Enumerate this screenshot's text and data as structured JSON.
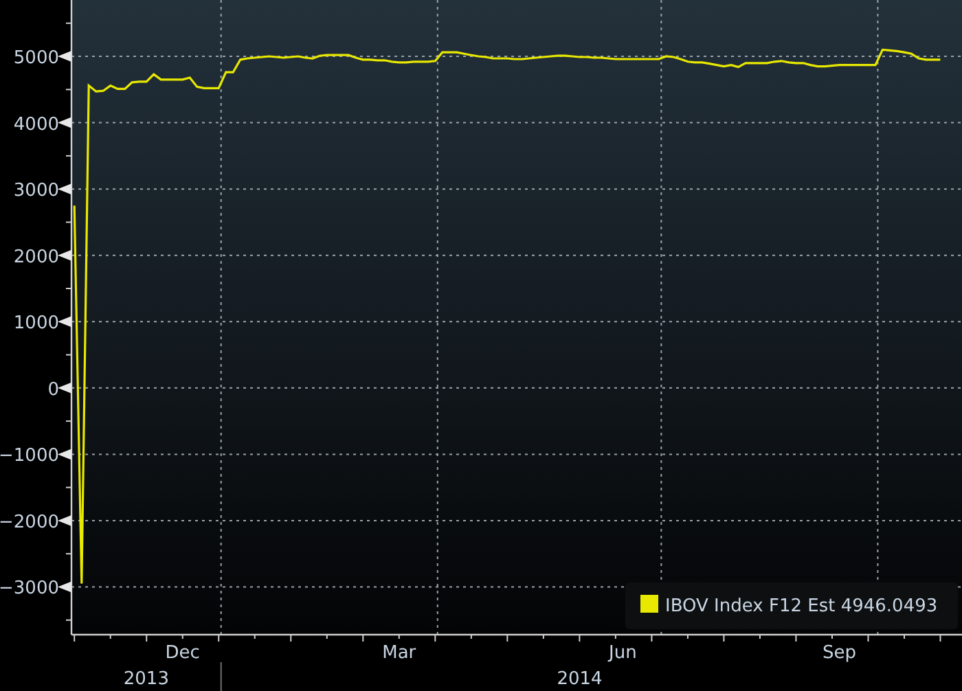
{
  "chart_data": {
    "type": "line",
    "grid": true,
    "ylim": [
      -3720,
      5850
    ],
    "yticks": [
      -3000,
      -2000,
      -1000,
      0,
      1000,
      2000,
      3000,
      4000,
      5000
    ],
    "categories": [
      null,
      null,
      null,
      null,
      null,
      null,
      null,
      null,
      null,
      null,
      null,
      null,
      null,
      null,
      null,
      "Dec",
      null,
      null,
      null,
      null,
      null,
      null,
      null,
      null,
      null,
      null,
      null,
      null,
      null,
      null,
      null,
      null,
      null,
      null,
      null,
      null,
      null,
      null,
      null,
      null,
      null,
      null,
      null,
      null,
      null,
      "Mar",
      null,
      null,
      null,
      null,
      null,
      null,
      null,
      null,
      null,
      null,
      null,
      null,
      null,
      null,
      null,
      null,
      null,
      null,
      null,
      null,
      null,
      null,
      null,
      null,
      null,
      null,
      null,
      null,
      null,
      null,
      "Jun",
      null,
      null,
      null,
      null,
      null,
      null,
      null,
      null,
      null,
      null,
      null,
      null,
      null,
      null,
      null,
      null,
      null,
      null,
      null,
      null,
      null,
      null,
      null,
      null,
      null,
      null,
      null,
      null,
      null,
      "Sep",
      null,
      null,
      null,
      null,
      null,
      null,
      null,
      null,
      null,
      null,
      null,
      null,
      null,
      null
    ],
    "annotations": [
      "2013",
      "2014"
    ],
    "series": [
      {
        "name": "IBOV Index F12 Est 4946.0493",
        "color": "#e8e800",
        "values": [
          2750,
          -2950,
          4560,
          4470,
          4480,
          4560,
          4510,
          4510,
          4610,
          4620,
          4620,
          4730,
          4650,
          4650,
          4650,
          4650,
          4680,
          4540,
          4520,
          4520,
          4520,
          4760,
          4760,
          4950,
          4970,
          4980,
          4990,
          5000,
          4990,
          4980,
          4990,
          5000,
          4980,
          4970,
          5010,
          5020,
          5020,
          5020,
          5020,
          4980,
          4950,
          4950,
          4940,
          4940,
          4920,
          4910,
          4910,
          4920,
          4920,
          4920,
          4930,
          5060,
          5060,
          5060,
          5040,
          5020,
          5000,
          4990,
          4970,
          4970,
          4970,
          4960,
          4960,
          4970,
          4980,
          4990,
          5000,
          5010,
          5010,
          5000,
          4990,
          4990,
          4980,
          4980,
          4970,
          4960,
          4960,
          4960,
          4960,
          4960,
          4960,
          4960,
          5000,
          4990,
          4960,
          4920,
          4910,
          4910,
          4890,
          4870,
          4850,
          4870,
          4840,
          4900,
          4900,
          4900,
          4900,
          4920,
          4930,
          4910,
          4900,
          4900,
          4870,
          4850,
          4850,
          4860,
          4870,
          4870,
          4870,
          4870,
          4870,
          4870,
          5100,
          5090,
          5080,
          5060,
          5040,
          4970,
          4950,
          4950,
          4950
        ]
      }
    ]
  }
}
